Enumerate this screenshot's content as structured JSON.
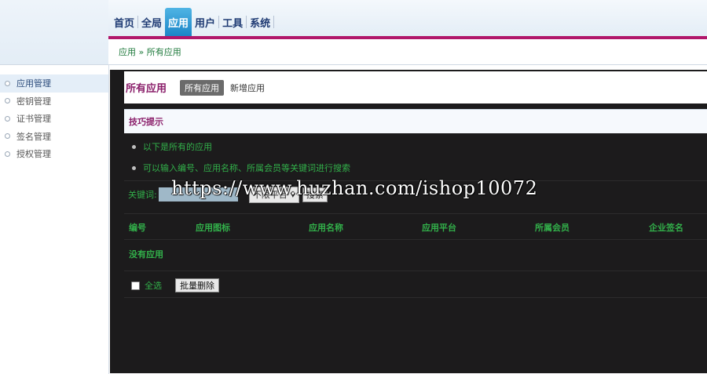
{
  "nav": {
    "items": [
      {
        "label": "首页"
      },
      {
        "label": "全局"
      },
      {
        "label": "应用"
      },
      {
        "label": "用户"
      },
      {
        "label": "工具"
      },
      {
        "label": "系统"
      }
    ],
    "active_index": 2
  },
  "breadcrumb": {
    "parent": "应用",
    "separator": " » ",
    "current": "所有应用"
  },
  "sidebar": {
    "items": [
      {
        "label": "应用管理"
      },
      {
        "label": "密钥管理"
      },
      {
        "label": "证书管理"
      },
      {
        "label": "签名管理"
      },
      {
        "label": "授权管理"
      }
    ],
    "active_index": 0
  },
  "main": {
    "title": "所有应用",
    "tabs": [
      {
        "label": "所有应用"
      },
      {
        "label": "新增应用"
      }
    ],
    "tips": {
      "title": "技巧提示",
      "items": [
        "以下是所有的应用",
        "可以输入编号、应用名称、所属会员等关键词进行搜索"
      ]
    },
    "search": {
      "label": "关键词:",
      "input_value": "",
      "platform_selected": "不限平台",
      "button_label": "搜索"
    },
    "table": {
      "columns": [
        "编号",
        "应用图标",
        "应用名称",
        "应用平台",
        "所属会员",
        "企业签名"
      ],
      "empty_text": "没有应用"
    },
    "bulk": {
      "select_all_label": "全选",
      "batch_delete_label": "批量删除"
    }
  },
  "watermark": "https://www.huzhan.com/ishop10072",
  "colors": {
    "accent_bar": "#b1176b",
    "nav_active": "#1c86c8",
    "main_bg": "#1c1b1c",
    "green_text": "#32b04a",
    "purple_title": "#8a1e6a"
  }
}
